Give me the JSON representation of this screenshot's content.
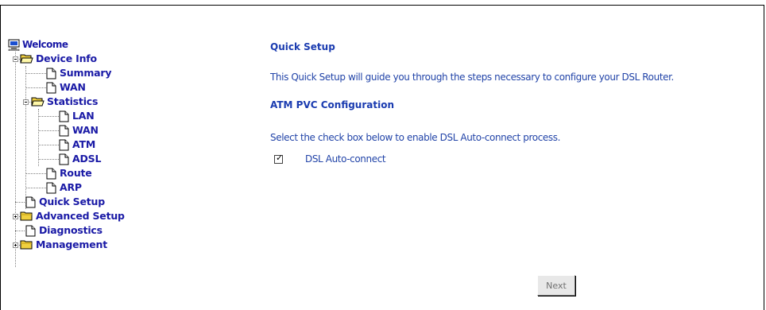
{
  "nav_tree": {
    "welcome": "Welcome",
    "device_info": "Device Info",
    "summary": "Summary",
    "wan": "WAN",
    "statistics": "Statistics",
    "stats_lan": "LAN",
    "stats_wan": "WAN",
    "stats_atm": "ATM",
    "stats_adsl": "ADSL",
    "route": "Route",
    "arp": "ARP",
    "quick_setup": "Quick Setup",
    "advanced_setup": "Advanced Setup",
    "diagnostics": "Diagnostics",
    "management": "Management"
  },
  "content": {
    "title": "Quick Setup",
    "intro": "This Quick Setup will guide you through the steps necessary to configure your DSL Router.",
    "section_title": "ATM PVC Configuration",
    "instruction": "Select the check box below to enable DSL Auto-connect process.",
    "checkbox_label": "DSL Auto-connect",
    "checkbox_checked": true,
    "next_button": "Next"
  },
  "colors": {
    "tree_text": "#1a1aa6",
    "content_text": "#2244a8",
    "folder_fill": "#f0d040"
  }
}
